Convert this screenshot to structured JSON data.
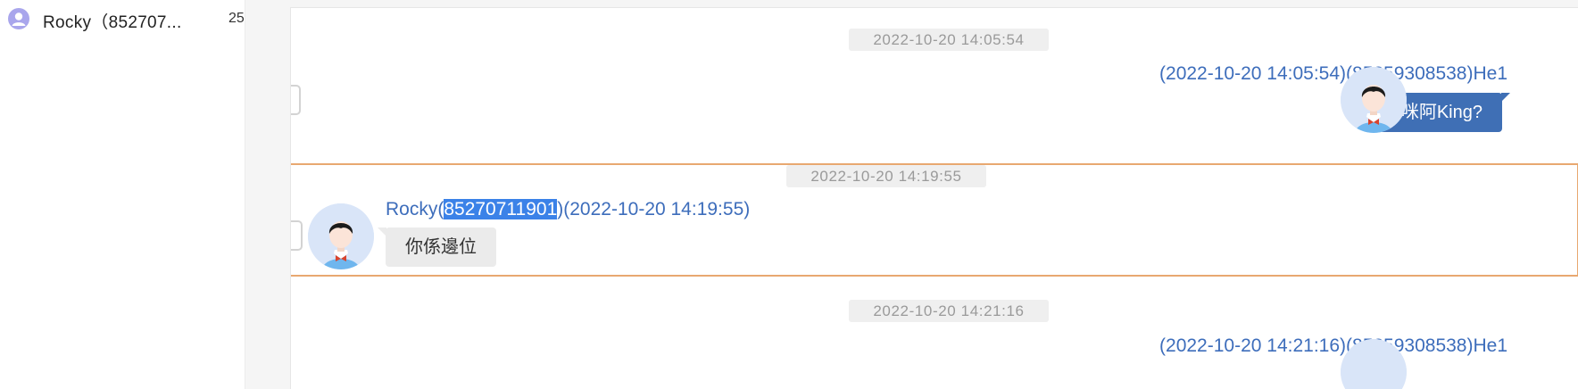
{
  "sidebar": {
    "contact": {
      "name": "Rocky（852707...",
      "count": "25"
    }
  },
  "chat": {
    "messages": [
      {
        "time": "2022-10-20 14:05:54",
        "direction": "out",
        "sender": "(2022-10-20 14:05:54)(85259308538)He1",
        "text": "係咪阿King?"
      },
      {
        "time": "2022-10-20 14:19:55",
        "direction": "in",
        "sender_name": "Rocky(",
        "sender_id": "85270711901",
        "sender_rest": ")(2022-10-20 14:19:55)",
        "text": "你係邊位"
      },
      {
        "time": "2022-10-20 14:21:16",
        "direction": "out",
        "sender": "(2022-10-20 14:21:16)(85259308538)He1"
      }
    ]
  },
  "colors": {
    "accent_blue": "#3f6fb5",
    "link_blue": "#3d6dbb",
    "selection_border": "#e8a870",
    "highlight": "#3b82e8"
  },
  "icons": {
    "contact_avatar": "user-icon",
    "message_avatar": "person-avatar-icon"
  }
}
